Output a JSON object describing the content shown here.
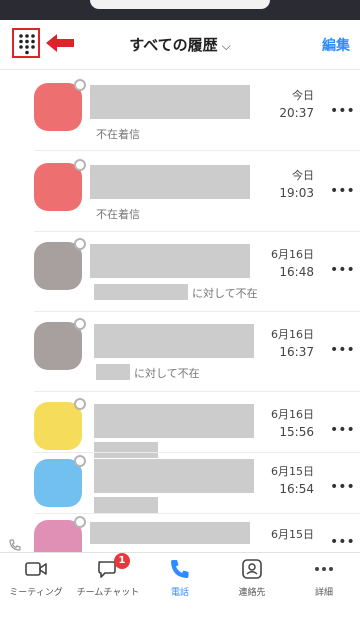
{
  "header": {
    "title": "すべての履歴",
    "dropdown_icon": "chevron-down-icon",
    "edit_label": "編集",
    "dialpad_icon": "dialpad-icon",
    "annotation_color": "#e0222a"
  },
  "calls": [
    {
      "avatar_color": "#ee6f6f",
      "subtext": "不在着信",
      "date": "今日",
      "time": "20:37"
    },
    {
      "avatar_color": "#ee6f6f",
      "subtext": "不在着信",
      "date": "今日",
      "time": "19:03"
    },
    {
      "avatar_color": "#a89f9f",
      "subtext": "に対して不在",
      "date": "6月16日",
      "time": "16:48"
    },
    {
      "avatar_color": "#a89f9f",
      "subtext": "に対して不在",
      "date": "6月16日",
      "time": "16:37"
    },
    {
      "avatar_color": "#f5dc5a",
      "subtext": "",
      "date": "6月16日",
      "time": "15:56"
    },
    {
      "avatar_color": "#72c0f0",
      "subtext": "",
      "date": "6月15日",
      "time": "16:54"
    },
    {
      "avatar_color": "#e08fb5",
      "subtext": "",
      "date": "6月15日",
      "time": ""
    }
  ],
  "more_label": "•••",
  "tabs": [
    {
      "label": "ミーティング",
      "icon": "video-camera-icon"
    },
    {
      "label": "チームチャット",
      "icon": "chat-bubble-icon",
      "badge": "1"
    },
    {
      "label": "電話",
      "icon": "phone-icon",
      "active": true
    },
    {
      "label": "連絡先",
      "icon": "contacts-icon"
    },
    {
      "label": "詳細",
      "icon": "more-dots-icon"
    }
  ],
  "colors": {
    "accent": "#2d8cff",
    "badge": "#e8383d"
  }
}
